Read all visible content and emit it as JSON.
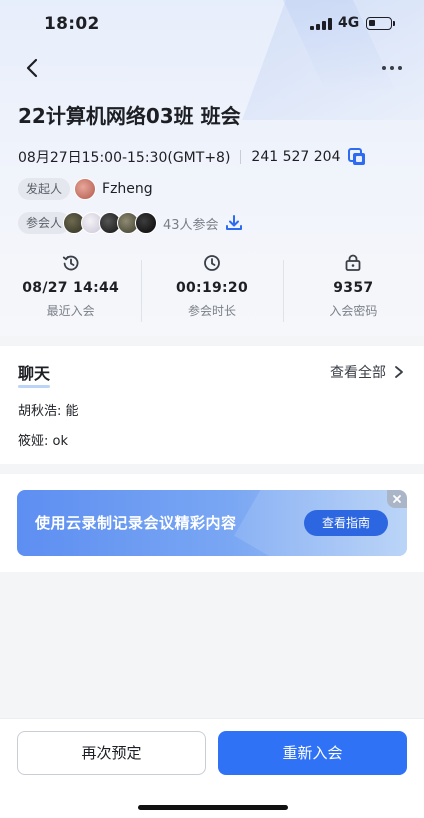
{
  "status_bar": {
    "time": "18:02",
    "network": "4G"
  },
  "meeting": {
    "title": "22计算机网络03班 班会",
    "datetime": "08月27日15:00-15:30(GMT+8)",
    "meeting_id": "241 527 204"
  },
  "host": {
    "tag": "发起人",
    "name": "Fzheng"
  },
  "attendees": {
    "tag": "参会人",
    "count_text": "43人参会"
  },
  "stats": [
    {
      "value": "08/27 14:44",
      "label": "最近入会",
      "icon": "history-icon"
    },
    {
      "value": "00:19:20",
      "label": "参会时长",
      "icon": "clock-icon"
    },
    {
      "value": "9357",
      "label": "入会密码",
      "icon": "lock-icon"
    }
  ],
  "chat": {
    "title": "聊天",
    "view_all": "查看全部",
    "messages": [
      {
        "text": "胡秋浩: 能"
      },
      {
        "text": "筱娅: ok"
      }
    ]
  },
  "banner": {
    "text": "使用云录制记录会议精彩内容",
    "button": "查看指南"
  },
  "actions": {
    "rebook": "再次预定",
    "rejoin": "重新入会"
  },
  "colors": {
    "primary": "#3072f6",
    "banner_start": "#5d8ef2"
  }
}
